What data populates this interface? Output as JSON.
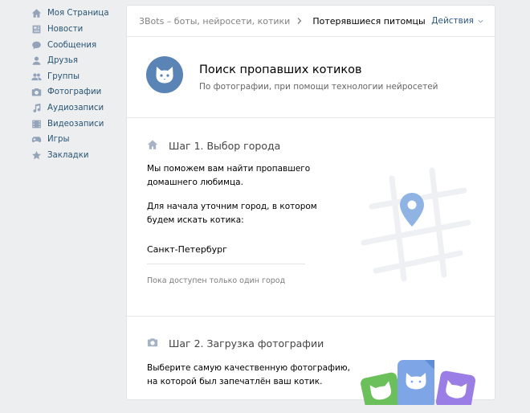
{
  "sidebar": {
    "items": [
      {
        "label": "Моя Страница",
        "icon": "home-icon"
      },
      {
        "label": "Новости",
        "icon": "news-icon"
      },
      {
        "label": "Сообщения",
        "icon": "messages-icon"
      },
      {
        "label": "Друзья",
        "icon": "friend-icon"
      },
      {
        "label": "Группы",
        "icon": "groups-icon"
      },
      {
        "label": "Фотографии",
        "icon": "camera-icon"
      },
      {
        "label": "Аудиозаписи",
        "icon": "music-note-icon"
      },
      {
        "label": "Видеозаписи",
        "icon": "film-icon"
      },
      {
        "label": "Игры",
        "icon": "gamepad-icon"
      },
      {
        "label": "Закладки",
        "icon": "star-icon"
      }
    ]
  },
  "header": {
    "breadcrumb_root": "3Bots – боты, нейросети, котики",
    "breadcrumb_current": "Потерявшиеся питомцы",
    "actions_label": "Действия"
  },
  "hero": {
    "title": "Поиск пропавших котиков",
    "subtitle": "По фотографии, при помощи технологии нейросетей"
  },
  "step1": {
    "title": "Шаг 1. Выбор города",
    "text_line1": "Мы поможем вам найти пропавшего",
    "text_line2": "домашнего любимца.",
    "text_line3": "Для начала уточним город, в котором",
    "text_line4": "будем искать котика:",
    "city_value": "Санкт-Петербург",
    "hint": "Пока доступен только один город"
  },
  "step2": {
    "title": "Шаг 2. Загрузка фотографии",
    "text_line1": "Выберите самую качественную фотографию,",
    "text_line2": "на которой был запечатлён ваш котик."
  },
  "colors": {
    "accent": "#5a84b6",
    "link": "#285473",
    "background": "#edeef0",
    "card": "#ffffff",
    "map_pin": "#8fb4e3",
    "photo_green": "#6cc05b",
    "photo_blue": "#7ea6e6",
    "photo_purple": "#9b7de6"
  }
}
